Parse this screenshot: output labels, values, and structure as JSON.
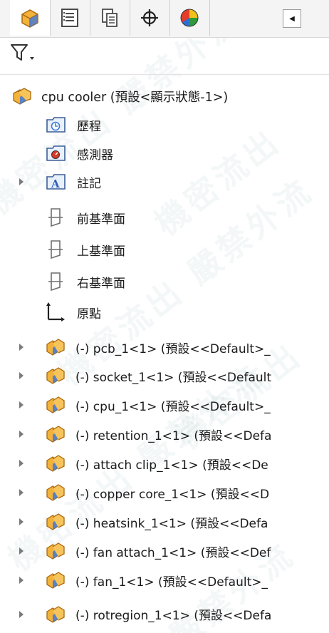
{
  "tabs": [
    {
      "name": "tab-feature-manager",
      "icon": "part-tree-icon"
    },
    {
      "name": "tab-property-manager",
      "icon": "property-list-icon"
    },
    {
      "name": "tab-configuration-manager",
      "icon": "configuration-icon"
    },
    {
      "name": "tab-dimxpert",
      "icon": "crosshair-icon"
    },
    {
      "name": "tab-display-manager",
      "icon": "display-pie-icon"
    }
  ],
  "filter": {
    "icon": "filter-icon"
  },
  "tree": {
    "root": {
      "label": "cpu cooler  (預設<顯示狀態-1>)",
      "icon": "assembly-icon"
    },
    "folders": [
      {
        "label": "歷程",
        "icon": "history-folder-icon",
        "expandable": false
      },
      {
        "label": "感測器",
        "icon": "sensor-folder-icon",
        "expandable": false
      },
      {
        "label": "註記",
        "icon": "annotation-folder-icon",
        "expandable": true
      }
    ],
    "planes": [
      {
        "label": "前基準面",
        "icon": "plane-icon"
      },
      {
        "label": "上基準面",
        "icon": "plane-icon"
      },
      {
        "label": "右基準面",
        "icon": "plane-icon"
      }
    ],
    "origin": {
      "label": "原點",
      "icon": "origin-icon"
    },
    "components": [
      {
        "label": "(-) pcb_1<1> (預設<<Default>_",
        "icon": "component-icon"
      },
      {
        "label": "(-) socket_1<1> (預設<<Default",
        "icon": "component-icon"
      },
      {
        "label": "(-) cpu_1<1> (預設<<Default>_",
        "icon": "component-icon"
      },
      {
        "label": "(-) retention_1<1> (預設<<Defa",
        "icon": "component-icon"
      },
      {
        "label": "(-) attach clip_1<1> (預設<<De",
        "icon": "component-icon"
      },
      {
        "label": "(-) copper core_1<1> (預設<<D",
        "icon": "component-icon"
      },
      {
        "label": "(-) heatsink_1<1> (預設<<Defa",
        "icon": "component-icon"
      },
      {
        "label": "(-) fan attach_1<1> (預設<<Def",
        "icon": "component-icon"
      },
      {
        "label": "(-) fan_1<1> (預設<<Default>_",
        "icon": "component-icon"
      },
      {
        "label": "(-) rotregion_1<1> (預設<<Defa",
        "icon": "component-icon"
      }
    ]
  },
  "watermark": "機密流出 嚴禁外流",
  "colors": {
    "accent": "#e8a020",
    "folder": "#3d7bd6",
    "plane": "#7d7d7d"
  }
}
